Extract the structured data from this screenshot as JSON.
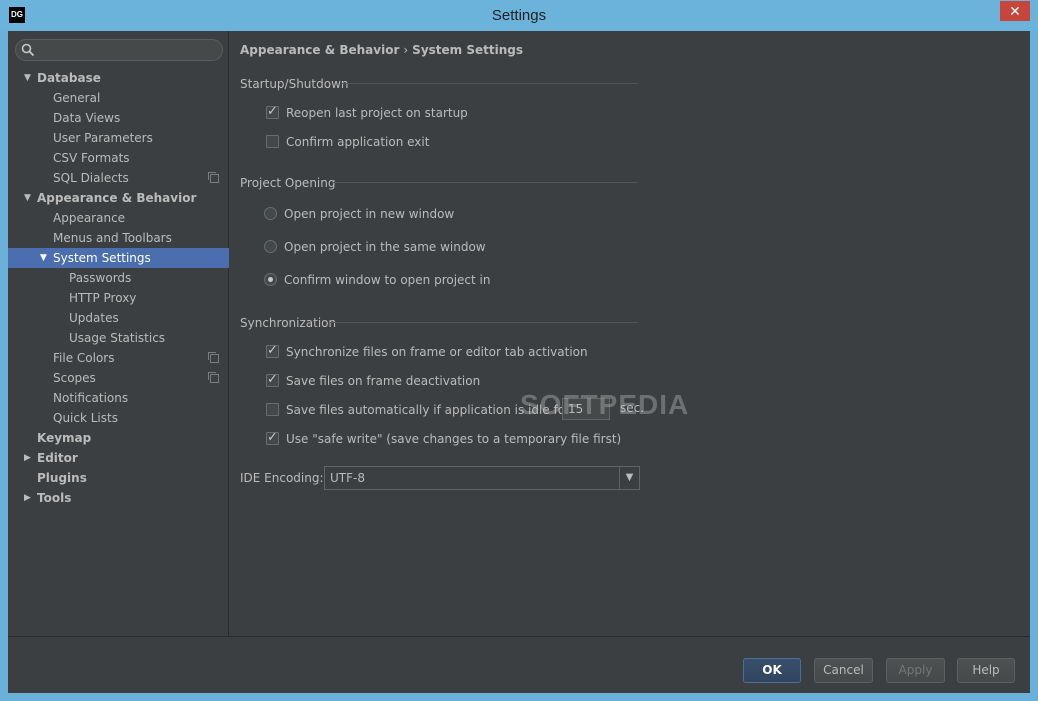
{
  "window": {
    "title": "Settings",
    "logo": "DG",
    "close": "✕"
  },
  "search": {
    "placeholder": ""
  },
  "tree": [
    {
      "label": "Database",
      "level": 0,
      "arrow": "▼",
      "bold": true
    },
    {
      "label": "General",
      "level": 1
    },
    {
      "label": "Data Views",
      "level": 1
    },
    {
      "label": "User Parameters",
      "level": 1
    },
    {
      "label": "CSV Formats",
      "level": 1
    },
    {
      "label": "SQL Dialects",
      "level": 1,
      "copy": true
    },
    {
      "label": "Appearance & Behavior",
      "level": 0,
      "arrow": "▼",
      "bold": true
    },
    {
      "label": "Appearance",
      "level": 1
    },
    {
      "label": "Menus and Toolbars",
      "level": 1
    },
    {
      "label": "System Settings",
      "level": 1,
      "arrow": "▼",
      "selected": true
    },
    {
      "label": "Passwords",
      "level": 2
    },
    {
      "label": "HTTP Proxy",
      "level": 2
    },
    {
      "label": "Updates",
      "level": 2
    },
    {
      "label": "Usage Statistics",
      "level": 2
    },
    {
      "label": "File Colors",
      "level": 1,
      "copy": true
    },
    {
      "label": "Scopes",
      "level": 1,
      "copy": true
    },
    {
      "label": "Notifications",
      "level": 1
    },
    {
      "label": "Quick Lists",
      "level": 1
    },
    {
      "label": "Keymap",
      "level": 0,
      "bold": true
    },
    {
      "label": "Editor",
      "level": 0,
      "arrow": "▶",
      "bold": true
    },
    {
      "label": "Plugins",
      "level": 0,
      "bold": true
    },
    {
      "label": "Tools",
      "level": 0,
      "arrow": "▶",
      "bold": true
    }
  ],
  "breadcrumb": {
    "parent": "Appearance & Behavior",
    "separator": "›",
    "current": "System Settings"
  },
  "startup": {
    "title": "Startup/Shutdown",
    "reopen_label": "Reopen last project on startup",
    "reopen_checked": true,
    "confirm_exit_label": "Confirm application exit",
    "confirm_exit_checked": false
  },
  "project_opening": {
    "title": "Project Opening",
    "options": [
      {
        "label": "Open project in new window",
        "selected": false
      },
      {
        "label": "Open project in the same window",
        "selected": false
      },
      {
        "label": "Confirm window to open project in",
        "selected": true
      }
    ]
  },
  "sync": {
    "title": "Synchronization",
    "sync_files_label": "Synchronize files on frame or editor tab activation",
    "sync_files_checked": true,
    "save_deactivation_label": "Save files on frame deactivation",
    "save_deactivation_checked": true,
    "save_idle_label": "Save files automatically if application is idle for",
    "save_idle_checked": false,
    "idle_seconds": "15",
    "seconds_unit": "sec.",
    "safe_write_label": "Use \"safe write\" (save changes to a temporary file first)",
    "safe_write_checked": true
  },
  "encoding": {
    "label": "IDE Encoding:",
    "value": "UTF-8"
  },
  "watermark": "SOFTPEDIA",
  "buttons": {
    "ok": "OK",
    "cancel": "Cancel",
    "apply": "Apply",
    "help": "Help"
  },
  "colors": {
    "background": "#3c3f41",
    "selection": "#4b6eaf",
    "titlebar": "#6cb3dc",
    "close": "#c7453a"
  }
}
